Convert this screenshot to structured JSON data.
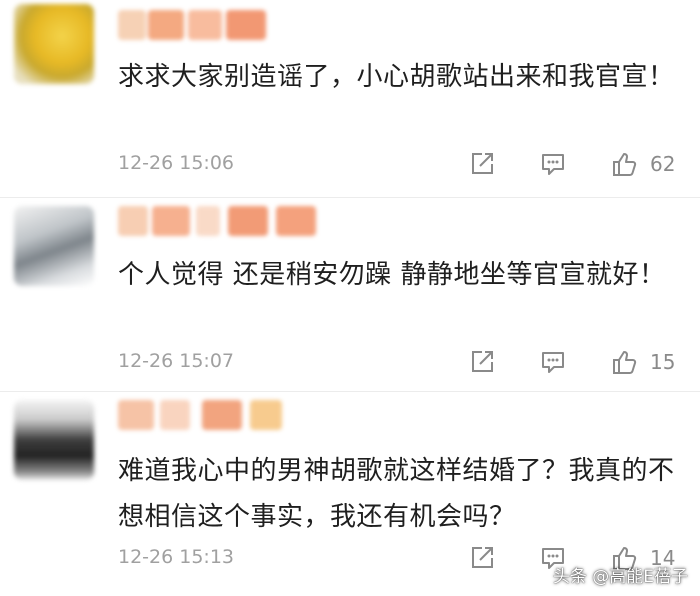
{
  "comments": [
    {
      "text": "求求大家别造谣了，小心胡歌站出来和我官宣！",
      "time": "12-26 15:06",
      "likes": "62"
    },
    {
      "text": "个人觉得  还是稍安勿躁  静静地坐等官宣就好！",
      "time": "12-26 15:07",
      "likes": "15"
    },
    {
      "text": "难道我心中的男神胡歌就这样结婚了？我真的不想相信这个事实，我还有机会吗？",
      "time": "12-26 15:13",
      "likes": "14"
    }
  ],
  "watermark": "头条 @高能E蓓子",
  "icons": {
    "share": "share-square-arrow-icon",
    "reply": "comment-bubble-icon",
    "like": "thumbs-up-icon"
  },
  "colors": {
    "text": "#1f1f1f",
    "meta": "#a0a0a0",
    "icon": "#8a8a8a"
  }
}
